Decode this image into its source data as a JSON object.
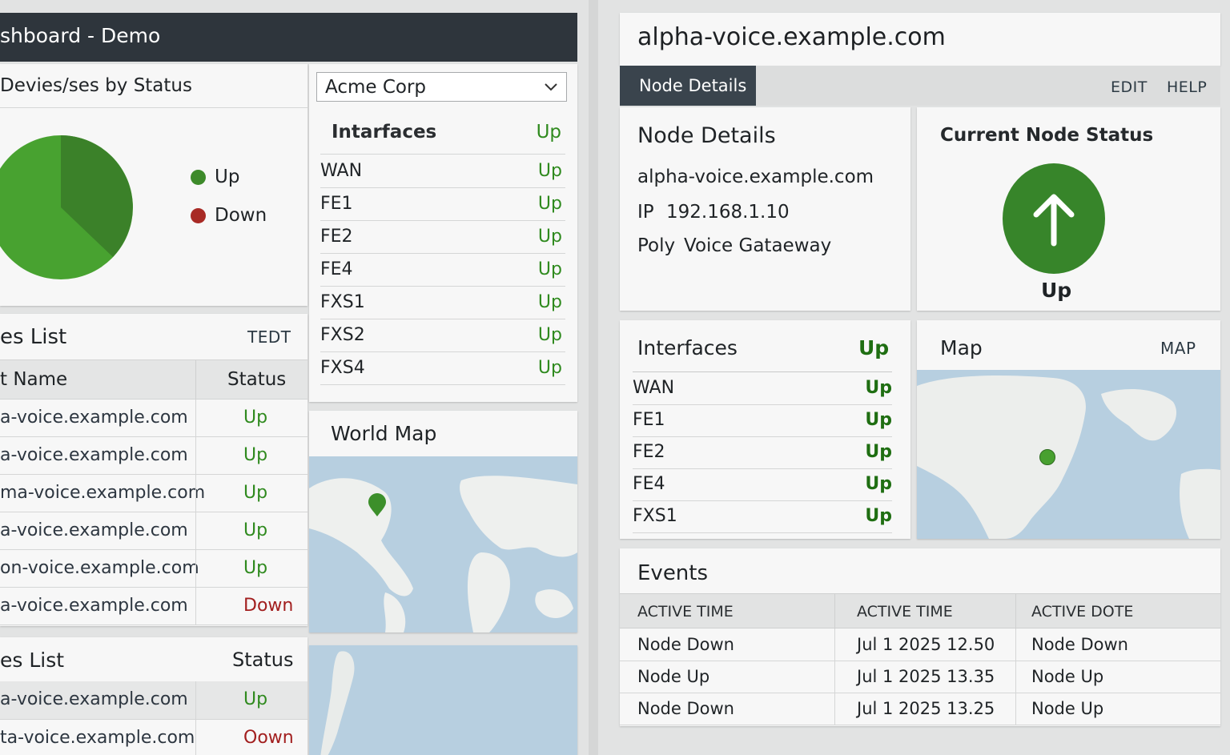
{
  "left": {
    "title": "shboard - Demo",
    "pie_card": {
      "title": "Devies/ses by Status",
      "legend": [
        {
          "label": "Up",
          "color": "#3d8a2a"
        },
        {
          "label": "Down",
          "color": "#a82a25"
        }
      ]
    },
    "customer_select": {
      "value": "Acme Corp"
    },
    "interfaces": {
      "header_name": "Intarfaces",
      "header_status": "Up",
      "rows": [
        {
          "name": "WAN",
          "status": "Up"
        },
        {
          "name": "FE1",
          "status": "Up"
        },
        {
          "name": "FE2",
          "status": "Up"
        },
        {
          "name": "FE4",
          "status": "Up"
        },
        {
          "name": "FXS1",
          "status": "Up"
        },
        {
          "name": "FXS2",
          "status": "Up"
        },
        {
          "name": "FXS4",
          "status": "Up"
        }
      ]
    },
    "devices_list": {
      "title": "es List",
      "edit_link": "TEDT",
      "col_name": "t Name",
      "col_status": "Status",
      "rows": [
        {
          "name": "a-voice.example.com",
          "status": "Up"
        },
        {
          "name": "a-voice.example.com",
          "status": "Up"
        },
        {
          "name": "ma-voice.example.com",
          "status": "Up"
        },
        {
          "name": "a-voice.example.com",
          "status": "Up"
        },
        {
          "name": "on-voice.example.com",
          "status": "Up"
        },
        {
          "name": "a-voice.example.com",
          "status": "Down"
        }
      ]
    },
    "devices_list2": {
      "title": "es List",
      "col_status": "Status",
      "rows": [
        {
          "name": "a-voice.example.com",
          "status": "Up"
        },
        {
          "name": "ta-voice.example.com",
          "status": "Oown"
        }
      ]
    },
    "world_map": {
      "title": "World Map"
    }
  },
  "right": {
    "hostname": "alpha-voice.example.com",
    "tabs": {
      "active": "Node Details",
      "edit": "EDIT",
      "help": "HELP"
    },
    "node_details": {
      "title": "Node Details",
      "hostname": "alpha-voice.example.com",
      "ip_label": "IP",
      "ip_value": "192.168.1.10",
      "vendor": "Poly",
      "model": "Voice Gataeway"
    },
    "status_card": {
      "title": "Current Node Status",
      "status": "Up"
    },
    "interfaces": {
      "header_name": "Interfaces",
      "header_status": "Up",
      "rows": [
        {
          "name": "WAN",
          "status": "Up"
        },
        {
          "name": "FE1",
          "status": "Up"
        },
        {
          "name": "FE2",
          "status": "Up"
        },
        {
          "name": "FE4",
          "status": "Up"
        },
        {
          "name": "FXS1",
          "status": "Up"
        }
      ]
    },
    "map": {
      "title": "Map",
      "link": "MAP"
    },
    "events": {
      "title": "Events",
      "columns": [
        "ACTIVE TIME",
        "ACTIVE TIME",
        "ACTIVE DOTE"
      ],
      "rows": [
        [
          "Node Down",
          "Jul 1 2025 12.50",
          "Node Down"
        ],
        [
          "Node Up",
          "Jul 1 2025 13.35",
          "Node Up"
        ],
        [
          "Node Down",
          "Jul 1 2025 13.25",
          "Node Up"
        ]
      ]
    }
  }
}
